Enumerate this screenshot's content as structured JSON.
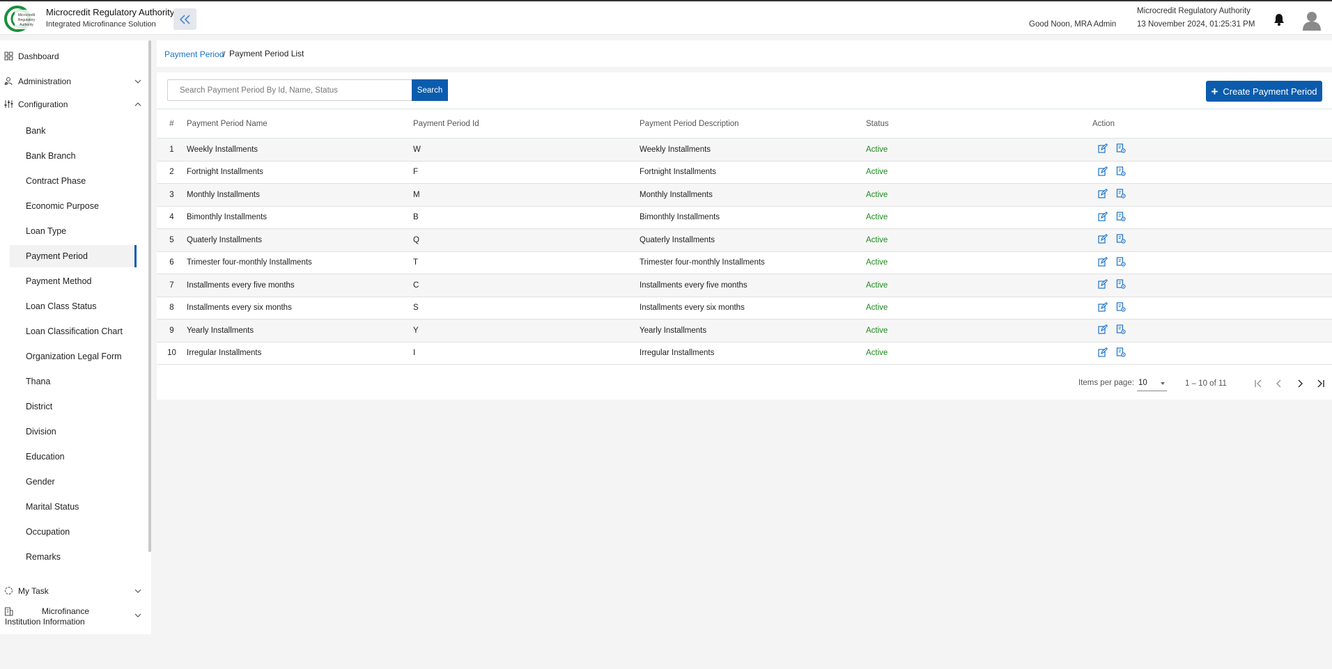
{
  "header": {
    "logo_text": "Microcredit Regulatory Authority",
    "title": "Microcredit Regulatory Authority",
    "subtitle": "Integrated Microfinance Solution",
    "greeting": "Good Noon, MRA Admin",
    "org_name": "Microcredit Regulatory Authority",
    "datetime": "13 November 2024, 01:25:31 PM"
  },
  "sidebar": {
    "dashboard": "Dashboard",
    "administration": "Administration",
    "configuration": "Configuration",
    "config_items": [
      "Bank",
      "Bank Branch",
      "Contract Phase",
      "Economic Purpose",
      "Loan Type",
      "Payment Period",
      "Payment Method",
      "Loan Class Status",
      "Loan Classification Chart",
      "Organization Legal Form",
      "Thana",
      "District",
      "Division",
      "Education",
      "Gender",
      "Marital Status",
      "Occupation",
      "Remarks"
    ],
    "active_item": "Payment Period",
    "my_task": "My Task",
    "mfi_info": "Microfinance Institution Information"
  },
  "breadcrumb": {
    "parent": "Payment Period",
    "separator": "/",
    "current": "Payment Period List"
  },
  "search": {
    "placeholder": "Search Payment Period By Id, Name, Status",
    "value": "",
    "button_label": "Search"
  },
  "create_button_label": "Create Payment Period",
  "table": {
    "columns": [
      "#",
      "Payment Period Name",
      "Payment Period Id",
      "Payment Period Description",
      "Status",
      "Action"
    ],
    "rows": [
      {
        "num": "1",
        "name": "Weekly Installments",
        "id": "W",
        "description": "Weekly Installments",
        "status": "Active"
      },
      {
        "num": "2",
        "name": "Fortnight Installments",
        "id": "F",
        "description": "Fortnight Installments",
        "status": "Active"
      },
      {
        "num": "3",
        "name": "Monthly Installments",
        "id": "M",
        "description": "Monthly Installments",
        "status": "Active"
      },
      {
        "num": "4",
        "name": "Bimonthly Installments",
        "id": "B",
        "description": "Bimonthly Installments",
        "status": "Active"
      },
      {
        "num": "5",
        "name": "Quaterly Installments",
        "id": "Q",
        "description": "Quaterly Installments",
        "status": "Active"
      },
      {
        "num": "6",
        "name": "Trimester four-monthly Installments",
        "id": "T",
        "description": "Trimester four-monthly Installments",
        "status": "Active"
      },
      {
        "num": "7",
        "name": "Installments every five months",
        "id": "C",
        "description": "Installments every five months",
        "status": "Active"
      },
      {
        "num": "8",
        "name": "Installments every six months",
        "id": "S",
        "description": "Installments every six months",
        "status": "Active"
      },
      {
        "num": "9",
        "name": "Yearly Installments",
        "id": "Y",
        "description": "Yearly Installments",
        "status": "Active"
      },
      {
        "num": "10",
        "name": "Irregular Installments",
        "id": "I",
        "description": "Irregular Installments",
        "status": "Active"
      }
    ]
  },
  "paginator": {
    "items_per_page_label": "Items per page:",
    "items_per_page": "10",
    "range": "1 – 10 of 11"
  },
  "colors": {
    "primary": "#0b5cad",
    "link": "#1a73c8",
    "active_status": "#1d8a1d",
    "page_bg": "#f4f4f4"
  }
}
